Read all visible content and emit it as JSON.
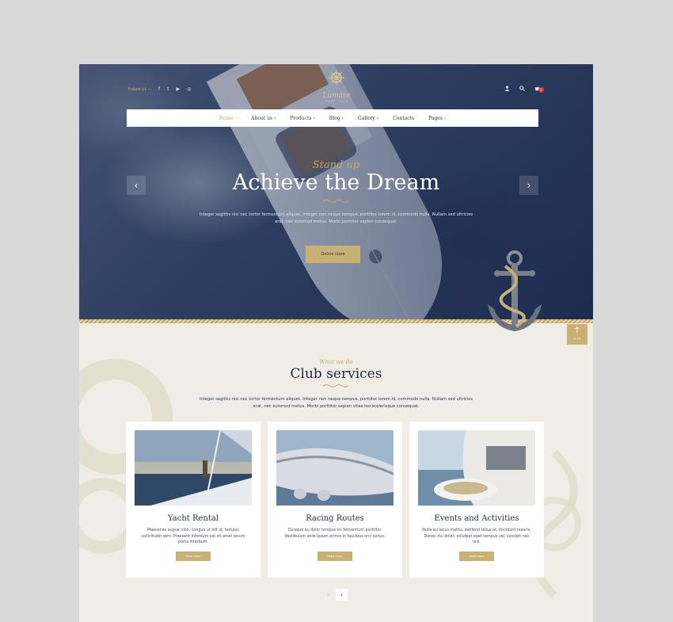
{
  "topbar": {
    "follow_label": "Follow us —",
    "socials": [
      "f",
      "t",
      "▶",
      "◎"
    ],
    "cart_count": "0"
  },
  "logo": {
    "name": "Lumare",
    "tagline": "YACHT · CLUB"
  },
  "nav": {
    "items": [
      "Home ›",
      "About us ›",
      "Products ›",
      "Blog ›",
      "Gallery ›",
      "Contacts",
      "Pages ›"
    ]
  },
  "hero": {
    "script": "Stand up",
    "title": "Achieve the Dream",
    "text": "Integer sagittis nisi nec tortor fermentum aliquet. Integer non neque tempus, porttitor lorem id, commodo nulla. Nullam sed ultricies erat, nec euismod metus. Morbi porttitor sapien consequat.",
    "button": "Online store",
    "prev_arrow": "‹",
    "next_arrow": "›"
  },
  "scroll_top": {
    "arrow": "↑",
    "label": "go top"
  },
  "services": {
    "script": "What we do",
    "title": "Club services",
    "text": "Integer sagittis nisi nec tortor fermentum aliquet. Integer non neque tempus, porttitor lorem id, commodo nulla. Nullam sed ultricies erat, nec euismod metus. Morbi porttitor sapien vitae leo scelerisque consequat.",
    "cards": [
      {
        "title": "Yacht Rental",
        "desc": "Maecenas augue nibh, congue ut elit id, tempus sollicitudin sem. Praesent interdum est sit amet ipsum porta interdum.",
        "button": "Read more"
      },
      {
        "title": "Racing Routes",
        "desc": "Quisque eu dolor tempus mi fermentum porttitor. Vestibulum ante ipsum primis in faucibus orci luctus.",
        "button": "Read more"
      },
      {
        "title": "Events and Activities",
        "desc": "Nulla eu lacus mattis, eleifend tellus at, tincidunt mauris. Donec dui dolor, volutpat eget tempus vel, suscipit nec nisl.",
        "button": "Read more"
      }
    ],
    "pager_prev": "‹",
    "pager_next": "›"
  },
  "colors": {
    "accent_gold": "#c9b074",
    "navy": "#1f2a45",
    "hero_blue": "#34466b",
    "cream": "#efede6"
  }
}
